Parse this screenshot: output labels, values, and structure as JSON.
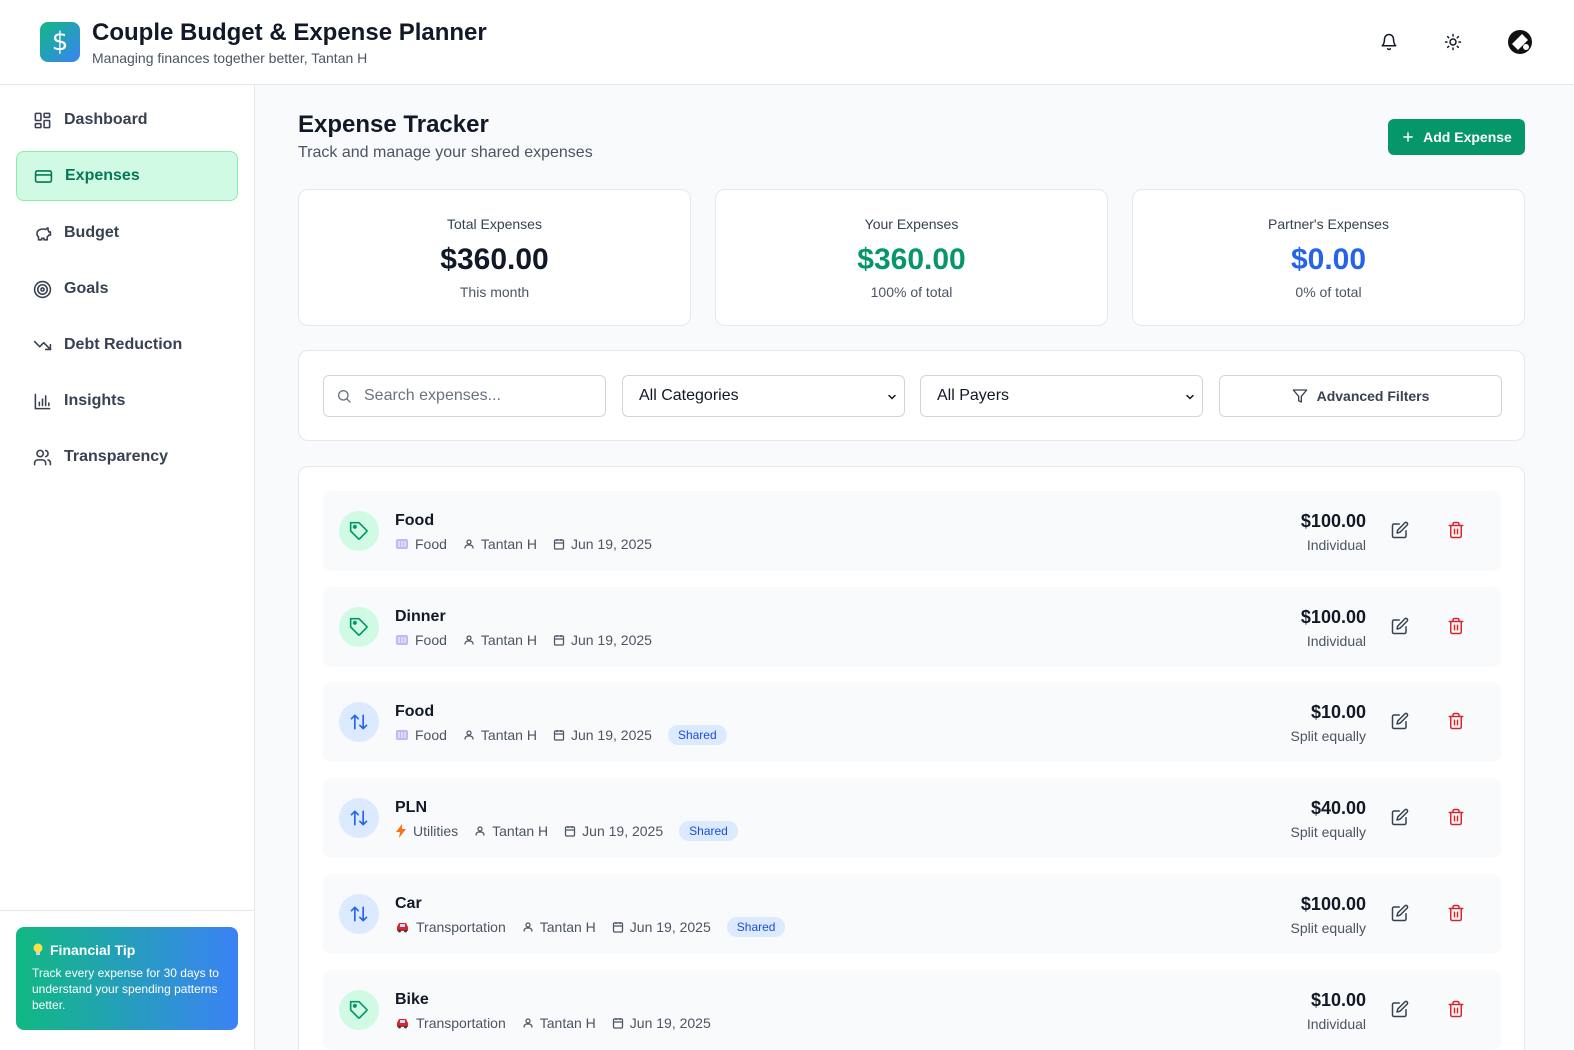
{
  "app": {
    "title": "Couple Budget & Expense Planner",
    "subtitle": "Managing finances together better, Tantan H",
    "logo_symbol": "$"
  },
  "header_icons": [
    "bell-icon",
    "sun-icon",
    "avatar"
  ],
  "sidebar": {
    "items": [
      {
        "label": "Dashboard",
        "icon": "grid-icon",
        "active": false
      },
      {
        "label": "Expenses",
        "icon": "credit-card-icon",
        "active": true
      },
      {
        "label": "Budget",
        "icon": "piggy-bank-icon",
        "active": false
      },
      {
        "label": "Goals",
        "icon": "target-icon",
        "active": false
      },
      {
        "label": "Debt Reduction",
        "icon": "trending-down-icon",
        "active": false
      },
      {
        "label": "Insights",
        "icon": "bar-chart-icon",
        "active": false
      },
      {
        "label": "Transparency",
        "icon": "users-icon",
        "active": false
      }
    ],
    "tip": {
      "title": "Financial Tip",
      "text": "Track every expense for 30 days to understand your spending patterns better."
    }
  },
  "main": {
    "title": "Expense Tracker",
    "subtitle": "Track and manage your shared expenses",
    "add_button": "Add Expense",
    "stats": [
      {
        "label": "Total Expenses",
        "value": "$360.00",
        "sub": "This month",
        "color": "#111827"
      },
      {
        "label": "Your Expenses",
        "value": "$360.00",
        "sub": "100% of total",
        "color": "#059669"
      },
      {
        "label": "Partner's Expenses",
        "value": "$0.00",
        "sub": "0% of total",
        "color": "#2563eb"
      }
    ],
    "filters": {
      "search_placeholder": "Search expenses...",
      "category": "All Categories",
      "payer": "All Payers",
      "advanced": "Advanced Filters"
    },
    "expenses": [
      {
        "title": "Food",
        "category": "Food",
        "category_icon": "plate-icon",
        "payer": "Tantan H",
        "date": "Jun 19, 2025",
        "shared": false,
        "amount": "$100.00",
        "split": "Individual",
        "icon": "tag-icon"
      },
      {
        "title": "Dinner",
        "category": "Food",
        "category_icon": "plate-icon",
        "payer": "Tantan H",
        "date": "Jun 19, 2025",
        "shared": false,
        "amount": "$100.00",
        "split": "Individual",
        "icon": "tag-icon"
      },
      {
        "title": "Food",
        "category": "Food",
        "category_icon": "plate-icon",
        "payer": "Tantan H",
        "date": "Jun 19, 2025",
        "shared": true,
        "badge": "Shared",
        "amount": "$10.00",
        "split": "Split equally",
        "icon": "arrows-updown-icon"
      },
      {
        "title": "PLN",
        "category": "Utilities",
        "category_icon": "lightning-icon",
        "payer": "Tantan H",
        "date": "Jun 19, 2025",
        "shared": true,
        "badge": "Shared",
        "amount": "$40.00",
        "split": "Split equally",
        "icon": "arrows-updown-icon"
      },
      {
        "title": "Car",
        "category": "Transportation",
        "category_icon": "car-icon",
        "payer": "Tantan H",
        "date": "Jun 19, 2025",
        "shared": true,
        "badge": "Shared",
        "amount": "$100.00",
        "split": "Split equally",
        "icon": "arrows-updown-icon"
      },
      {
        "title": "Bike",
        "category": "Transportation",
        "category_icon": "car-icon",
        "payer": "Tantan H",
        "date": "Jun 19, 2025",
        "shared": false,
        "amount": "$10.00",
        "split": "Individual",
        "icon": "tag-icon"
      }
    ]
  }
}
